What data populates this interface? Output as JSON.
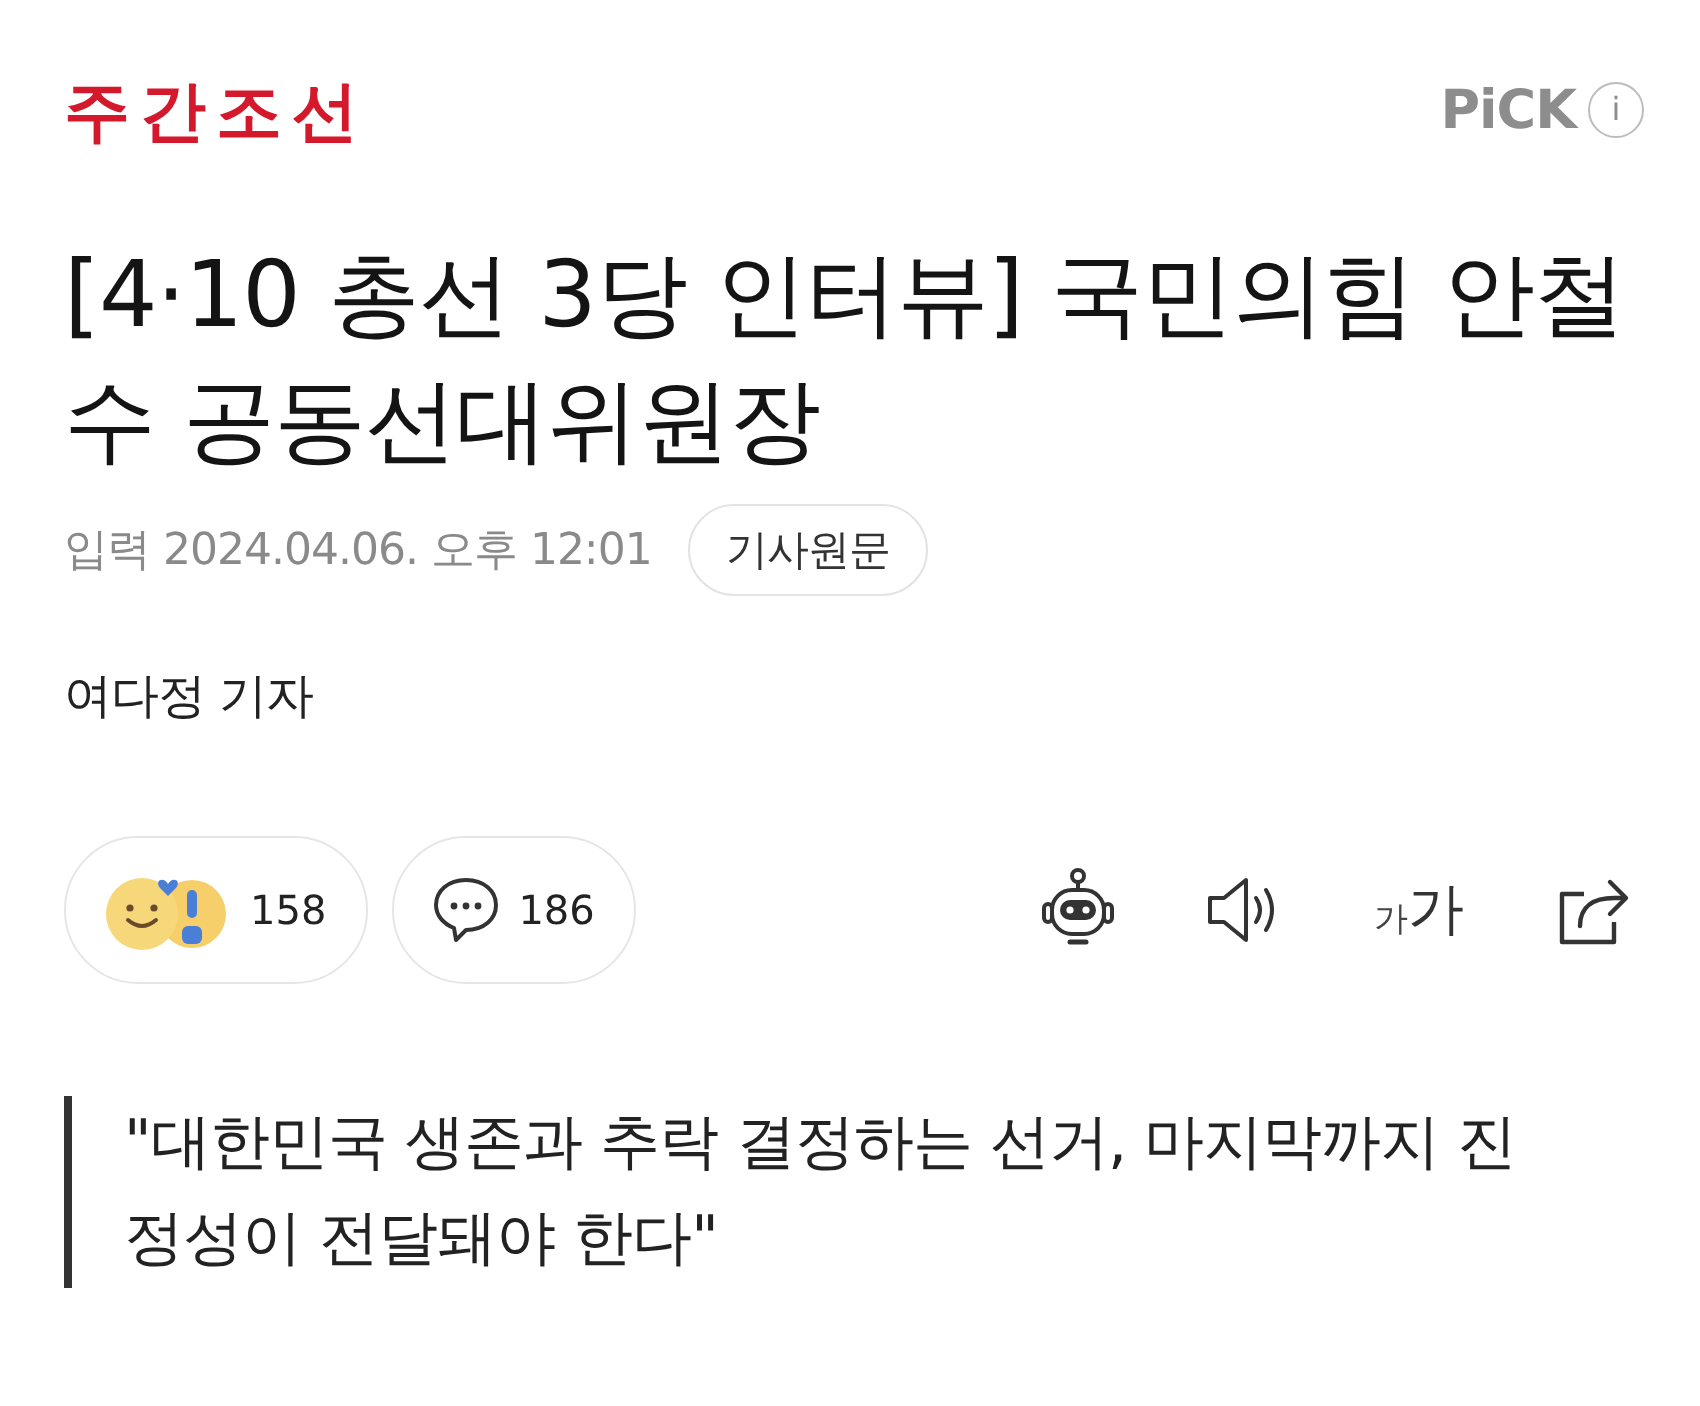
{
  "header": {
    "logo": "주간조선",
    "pick": "PiCK",
    "info": "i"
  },
  "title": {
    "lines": [
      "[4·10 총선 3당 인터뷰] 국민의힘 안철",
      "수 공동선대위원장"
    ]
  },
  "meta": {
    "date_label": "입력",
    "date": "2024.04.06. 오후 12:01",
    "original_button": "기사원문"
  },
  "reporter": "여다정 기자",
  "reactions": [
    {
      "kind": "emotion",
      "count": "158"
    },
    {
      "kind": "comment",
      "count": "186"
    }
  ],
  "tools": [
    {
      "kind": "robot"
    },
    {
      "kind": "speaker"
    },
    {
      "kind": "font-size",
      "small": "가",
      "large": "가"
    },
    {
      "kind": "share"
    }
  ],
  "quote": {
    "lines": [
      "\"대한민국 생존과 추락 결정하는 선거, 마지막까지 진",
      "정성이 전달돼야 한다\""
    ]
  }
}
